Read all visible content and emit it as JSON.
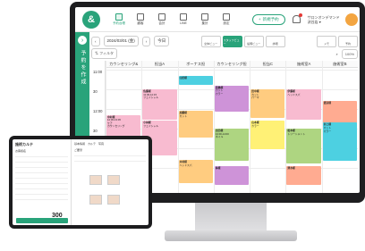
{
  "topbar": {
    "logo": "&",
    "nav": [
      "予約台帳",
      "顧客",
      "会計",
      "LINE",
      "集計",
      "設定"
    ],
    "new_button": "新規予約",
    "shop_line1": "サロンオンデマンド",
    "shop_line2": "渋谷店 ▾"
  },
  "sidebar": {
    "arrow": "›",
    "label": "予約を作成"
  },
  "toolbar": {
    "prev": "‹",
    "date": "2024/03/01 (金)",
    "next": "›",
    "today": "今日",
    "tools": [
      "全体ビュー",
      "スタッフビュー",
      "設備ビュー",
      "詳細"
    ],
    "tools_right": [
      "メモ",
      "予約"
    ]
  },
  "bar2": {
    "filter": "フィルタ",
    "zoom": "100%"
  },
  "grid": {
    "columns": [
      "カウンセリング&",
      "担当A",
      "ボーナス担",
      "カウンセリング担",
      "担当C",
      "施術室A",
      "施術室B"
    ],
    "times": [
      "11:00",
      "30",
      "12:00",
      "30",
      "13:00",
      "30"
    ],
    "appointments": [
      {
        "col": 1,
        "row": 1,
        "rows": 1.6,
        "color": "#f8bbd0",
        "title": "佐藤様",
        "lines": [
          "11:30-12:15",
          "フェイシャル"
        ]
      },
      {
        "col": 3,
        "row": 0.8,
        "rows": 1.4,
        "color": "#ce93d8",
        "title": "高橋様",
        "lines": [
          "カット",
          "カラー"
        ]
      },
      {
        "col": 2,
        "row": 0.3,
        "rows": 0.5,
        "color": "#4dd0e1",
        "title": "山田様",
        "lines": []
      },
      {
        "col": 4,
        "row": 1,
        "rows": 1.5,
        "color": "#ffcc80",
        "title": "田中様",
        "lines": [
          "カット",
          "パーマ"
        ]
      },
      {
        "col": 5,
        "row": 1,
        "rows": 1.6,
        "color": "#f8bbd0",
        "title": "伊藤様",
        "lines": [
          "ヘッドスパ"
        ]
      },
      {
        "col": 6,
        "row": 1.6,
        "rows": 1.2,
        "color": "#ffab91",
        "title": "渡辺様",
        "lines": []
      },
      {
        "col": 0,
        "row": 2.3,
        "rows": 2.6,
        "color": "#f8bbd0",
        "title": "中村様",
        "lines": [
          "12:30-13:45",
          "ケア",
          "カウンセリング"
        ]
      },
      {
        "col": 1,
        "row": 2.6,
        "rows": 1.8,
        "color": "#f8bbd0",
        "title": "小林様",
        "lines": [
          "フェイシャル"
        ]
      },
      {
        "col": 2,
        "row": 2.1,
        "rows": 1.4,
        "color": "#ffcc80",
        "title": "加藤様",
        "lines": [
          "カット"
        ]
      },
      {
        "col": 3,
        "row": 3.0,
        "rows": 1.7,
        "color": "#aed581",
        "title": "吉田様",
        "lines": [
          "13:00-14:00",
          "ネイル"
        ]
      },
      {
        "col": 4,
        "row": 2.6,
        "rows": 1.5,
        "color": "#fff176",
        "title": "山本様",
        "lines": [
          "カラー"
        ]
      },
      {
        "col": 5,
        "row": 3.0,
        "rows": 1.8,
        "color": "#aed581",
        "title": "松本様",
        "lines": [
          "トリートメント"
        ]
      },
      {
        "col": 6,
        "row": 2.7,
        "rows": 2.0,
        "color": "#4dd0e1",
        "title": "井上様",
        "lines": [
          "カット",
          "カラー"
        ]
      },
      {
        "col": 2,
        "row": 4.6,
        "rows": 1.2,
        "color": "#ffcc80",
        "title": "木村様",
        "lines": [
          "ヘッドスパ"
        ]
      },
      {
        "col": 3,
        "row": 4.9,
        "rows": 1.0,
        "color": "#ce93d8",
        "title": "林様",
        "lines": []
      },
      {
        "col": 5,
        "row": 4.9,
        "rows": 1.0,
        "color": "#ffab91",
        "title": "清水様",
        "lines": []
      }
    ]
  },
  "tablet": {
    "title": "施術カルテ",
    "name_label": "お客様名",
    "tabs": [
      "基本情報",
      "カルテ",
      "写真"
    ],
    "price": "300",
    "section": "ご要望"
  }
}
